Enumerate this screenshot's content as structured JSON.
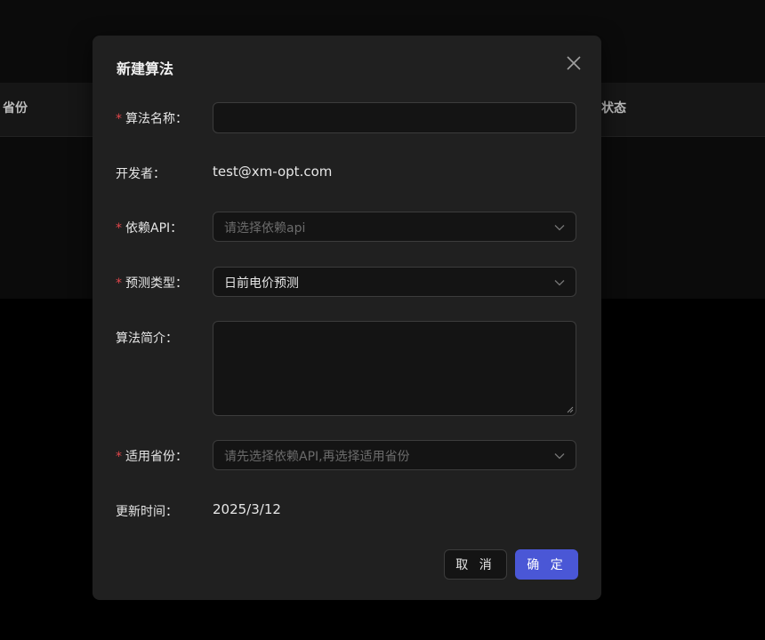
{
  "background": {
    "columns": [
      "省份",
      "状态"
    ]
  },
  "dialog": {
    "title": "新建算法",
    "fields": {
      "name": {
        "label": "算法名称：",
        "required": true,
        "value": "",
        "placeholder": ""
      },
      "developer": {
        "label": "开发者：",
        "value": "test@xm-opt.com"
      },
      "api": {
        "label": "依赖API：",
        "required": true,
        "placeholder": "请选择依赖api"
      },
      "type": {
        "label": "预测类型：",
        "required": true,
        "value": "日前电价预测"
      },
      "intro": {
        "label": "算法简介：",
        "value": ""
      },
      "province": {
        "label": "适用省份：",
        "required": true,
        "placeholder": "请先选择依赖API,再选择适用省份"
      },
      "updated": {
        "label": "更新时间：",
        "value": "2025/3/12"
      }
    },
    "buttons": {
      "cancel": "取 消",
      "ok": "确 定"
    }
  },
  "colors": {
    "primary": "#4a57d6",
    "required": "#e0464b",
    "dialog_bg": "#202020"
  }
}
